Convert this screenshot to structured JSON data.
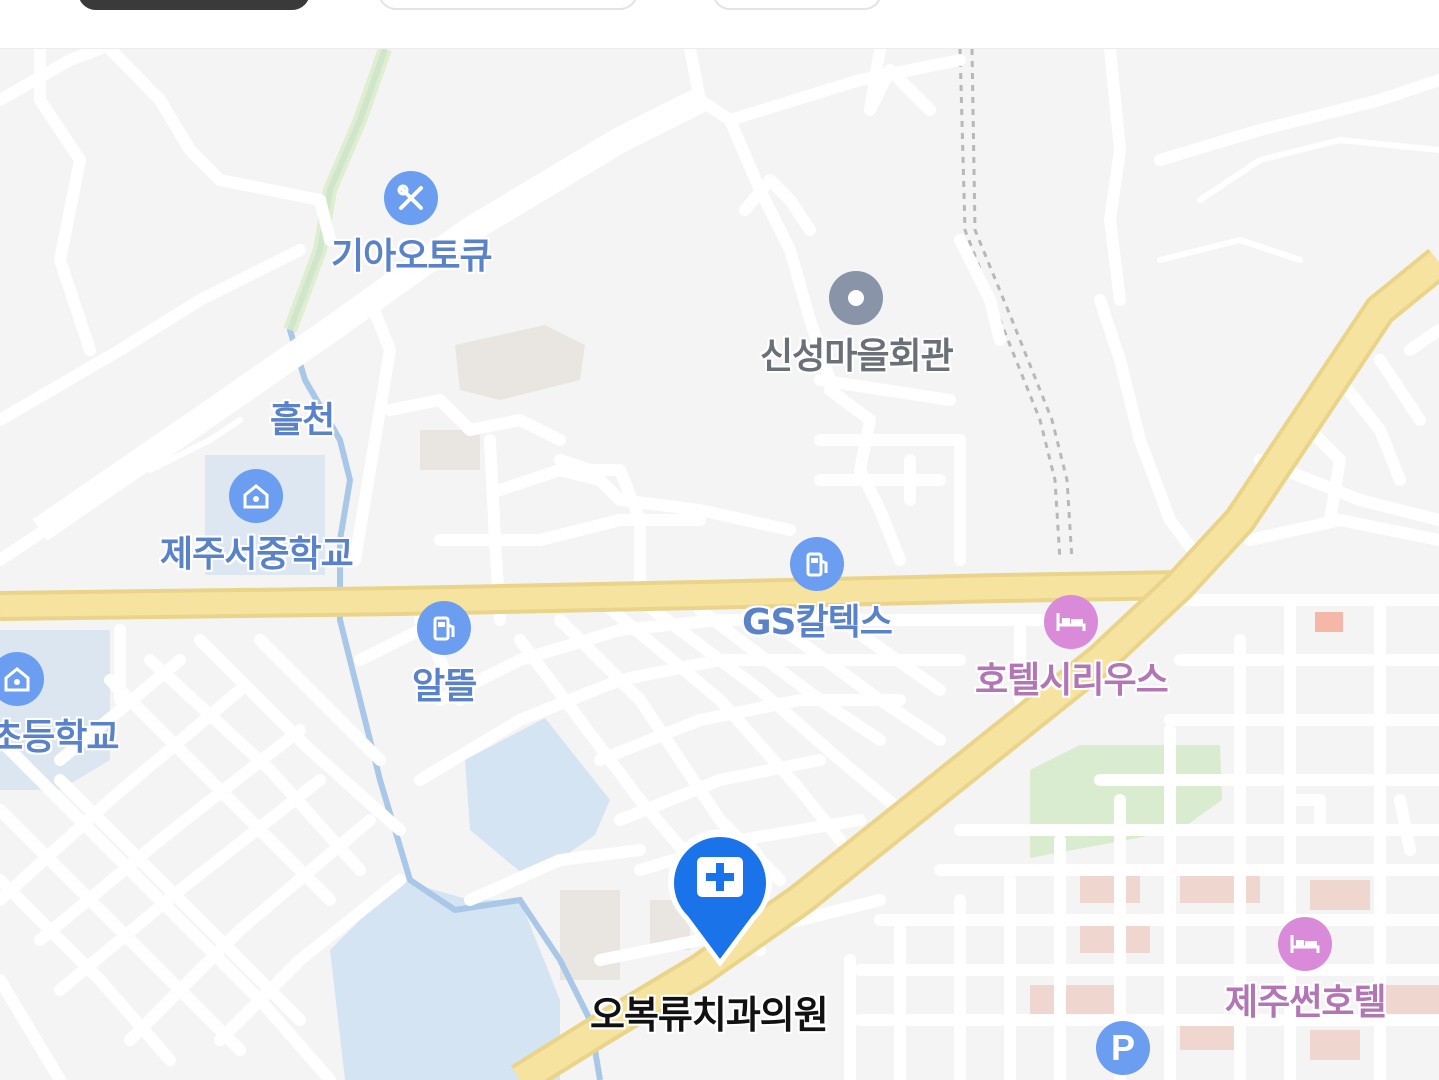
{
  "marker": {
    "label": "오복류치과의원",
    "icon": "dental-clinic-cross-icon",
    "color": "#1a73e8"
  },
  "pois": [
    {
      "name": "기아오토큐",
      "icon": "car-repair-wrench-icon",
      "color": "#6b9ef0"
    },
    {
      "name": "신성마을회관",
      "icon": "community-hall-dot-icon",
      "color": "#8a94a8"
    },
    {
      "name": "흘천",
      "icon": "",
      "color": "#5a82c8"
    },
    {
      "name": "제주서중학교",
      "icon": "school-icon",
      "color": "#6b9ef0"
    },
    {
      "name": "GS칼텍스",
      "icon": "gas-station-icon",
      "color": "#6b9ef0"
    },
    {
      "name": "알뜰",
      "icon": "gas-station-icon",
      "color": "#6b9ef0"
    },
    {
      "name": "호텔시리우스",
      "icon": "hotel-bed-icon",
      "color": "#d98ad8"
    },
    {
      "name": "초등학교",
      "icon": "school-icon",
      "color": "#6b9ef0"
    },
    {
      "name": "제주썬호텔",
      "icon": "hotel-bed-icon",
      "color": "#d98ad8"
    },
    {
      "name": "",
      "icon": "parking-icon",
      "color": "#6b9ef0"
    }
  ],
  "colors": {
    "main_road": "#f5dc86",
    "water": "#d5e4f3",
    "park": "#d9ecd0",
    "background": "#f4f4f5"
  }
}
